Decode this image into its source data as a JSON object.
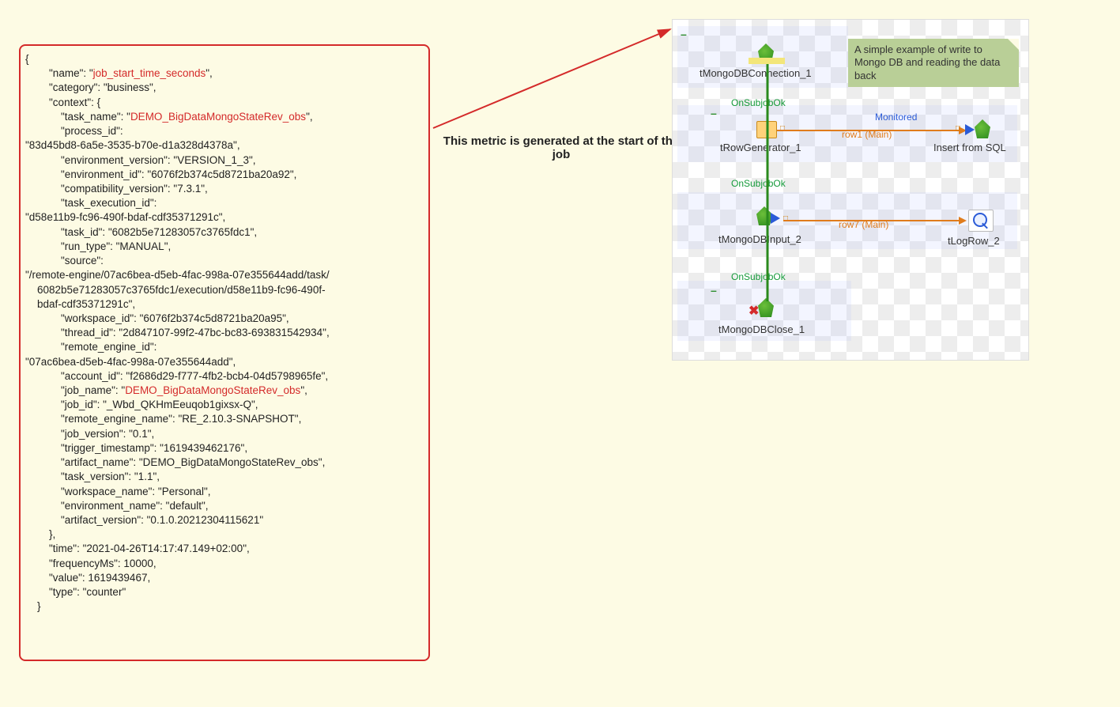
{
  "caption": "This metric is generated at the start of the job",
  "note_text": "A simple example of write to Mongo DB and reading the data back",
  "json_metric": {
    "name": "job_start_time_seconds",
    "category": "business",
    "context": {
      "task_name": "DEMO_BigDataMongoStateRev_obs",
      "process_id": "83d45bd8-6a5e-3535-b70e-d1a328d4378a",
      "environment_version": "VERSION_1_3",
      "environment_id": "6076f2b374c5d8721ba20a92",
      "compatibility_version": "7.3.1",
      "task_execution_id": "d58e11b9-fc96-490f-bdaf-cdf35371291c",
      "task_id": "6082b5e71283057c3765fdc1",
      "run_type": "MANUAL",
      "source": "/remote-engine/07ac6bea-d5eb-4fac-998a-07e355644add/task/6082b5e71283057c3765fdc1/execution/d58e11b9-fc96-490f-bdaf-cdf35371291c",
      "workspace_id": "6076f2b374c5d8721ba20a95",
      "thread_id": "2d847107-99f2-47bc-bc83-693831542934",
      "remote_engine_id": "07ac6bea-d5eb-4fac-998a-07e355644add",
      "account_id": "f2686d29-f777-4fb2-bcb4-04d5798965fe",
      "job_name": "DEMO_BigDataMongoStateRev_obs",
      "job_id": "_Wbd_QKHmEeuqob1gixsx-Q",
      "remote_engine_name": "RE_2.10.3-SNAPSHOT",
      "job_version": "0.1",
      "trigger_timestamp": "1619439462176",
      "artifact_name": "DEMO_BigDataMongoStateRev_obs",
      "task_version": "1.1",
      "workspace_name": "Personal",
      "environment_name": "default",
      "artifact_version": "0.1.0.20212304115621"
    },
    "time": "2021-04-26T14:17:47.149+02:00",
    "frequencyMs": 10000,
    "value": 1619439467,
    "type": "counter"
  },
  "highlight_keys": [
    "name",
    "task_name",
    "job_name"
  ],
  "highlight_values": {
    "name": "job_start_time_seconds",
    "task_name": "DEMO_BigDataMongoStateRev_obs",
    "job_name": "DEMO_BigDataMongoStateRev_obs"
  },
  "workflow": {
    "components": {
      "tMongoDBConnection_1": "tMongoDBConnection_1",
      "tRowGenerator_1": "tRowGenerator_1",
      "insert_from_sql": "Insert from SQL",
      "tMongoDBInput_2": "tMongoDBInput_2",
      "tLogRow_2": "tLogRow_2",
      "tMongoDBClose_1": "tMongoDBClose_1"
    },
    "links": {
      "onsubjobok": "OnSubjobOk",
      "row1": "row1 (Main)",
      "row7": "row7 (Main)",
      "monitored": "Monitored"
    }
  }
}
